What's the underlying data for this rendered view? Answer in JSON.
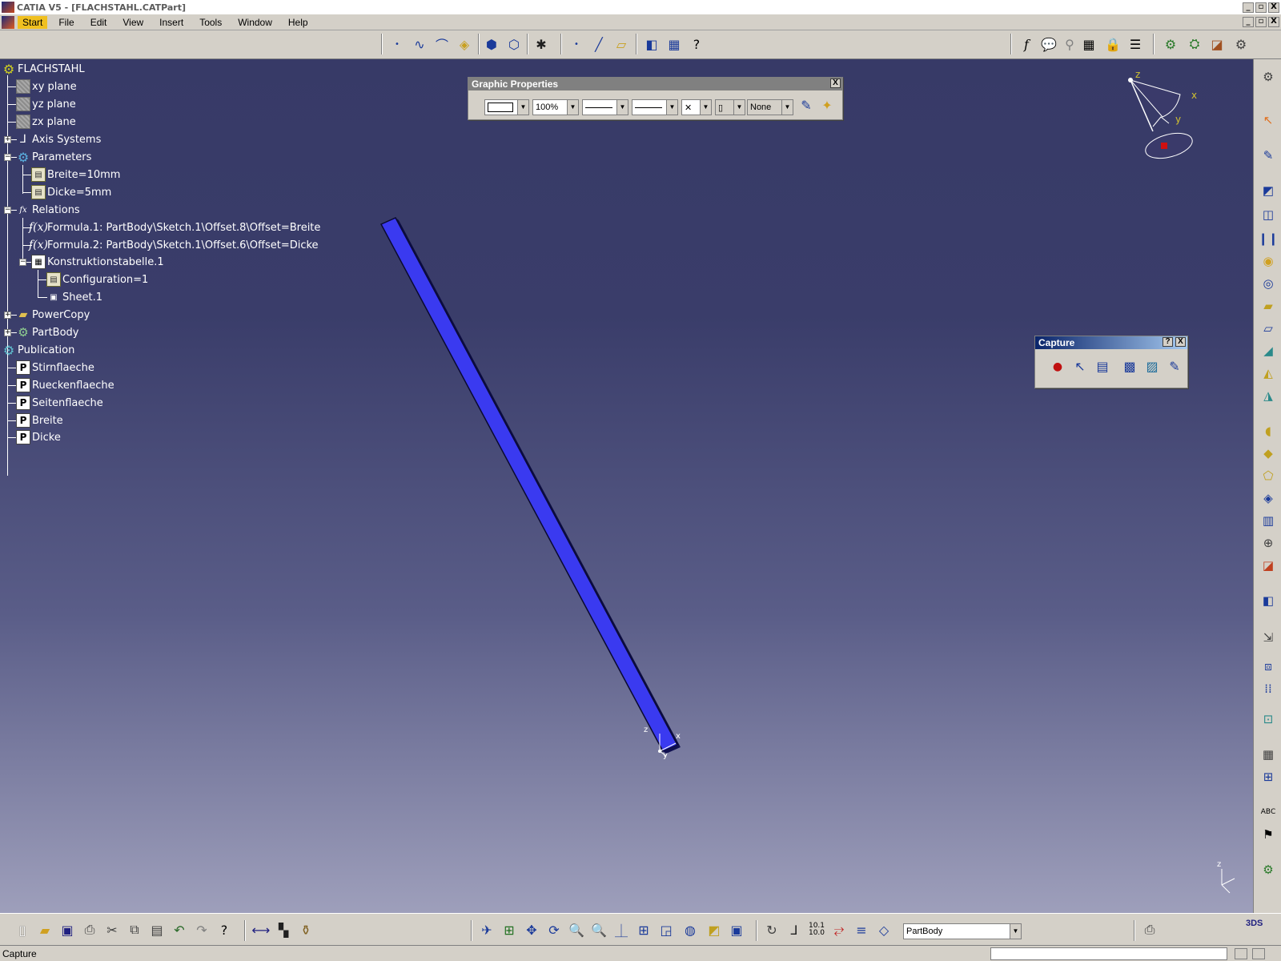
{
  "window": {
    "title": "CATIA V5 - [FLACHSTAHL.CATPart]",
    "controls": [
      "_",
      "▫",
      "X"
    ]
  },
  "menu": {
    "items": [
      "Start",
      "File",
      "Edit",
      "View",
      "Insert",
      "Tools",
      "Window",
      "Help"
    ]
  },
  "tree": {
    "root": "FLACHSTAHL",
    "nodes": {
      "xy_plane": "xy plane",
      "yz_plane": "yz plane",
      "zx_plane": "zx plane",
      "axis_systems": "Axis Systems",
      "parameters": "Parameters",
      "breite": "Breite=10mm",
      "dicke": "Dicke=5mm",
      "relations": "Relations",
      "formula1": "Formula.1: PartBody\\Sketch.1\\Offset.8\\Offset=Breite",
      "formula2": "Formula.2: PartBody\\Sketch.1\\Offset.6\\Offset=Dicke",
      "konstruktionstabelle": "Konstruktionstabelle.1",
      "configuration": "Configuration=1",
      "sheet": "Sheet.1",
      "powercopy": "PowerCopy",
      "partbody": "PartBody",
      "publication": "Publication",
      "stirnflaeche": "Stirnflaeche",
      "rueckenflaeche": "Rueckenflaeche",
      "seitenflaeche": "Seitenflaeche",
      "pub_breite": "Breite",
      "pub_dicke": "Dicke"
    },
    "formula_icon": "f(x)",
    "publication_icon": "P"
  },
  "graphic_properties": {
    "title": "Graphic Properties",
    "transparency": "100%",
    "layer": "None"
  },
  "capture": {
    "title": "Capture",
    "help": "?",
    "close": "X"
  },
  "compass": {
    "x": "x",
    "y": "y",
    "z": "z"
  },
  "origin_axes": {
    "x": "x",
    "y": "y",
    "z": "z"
  },
  "bottom_toolbar": {
    "current_body": "PartBody",
    "scale_label_top": "10.1",
    "scale_label_bottom": "10.0"
  },
  "statusbar": {
    "text": "Capture"
  },
  "colors": {
    "part_fill": "#3a3af0",
    "part_edge": "#0a0a30",
    "viewport_top": "#373a67",
    "viewport_bottom": "#9e9fbb",
    "graphic_props_title": "#808080",
    "capture_title": "#0a246a"
  },
  "icons": {
    "part_icon": "part-icon",
    "plane_icon": "plane-icon",
    "gear_icon": "gear-icon"
  }
}
